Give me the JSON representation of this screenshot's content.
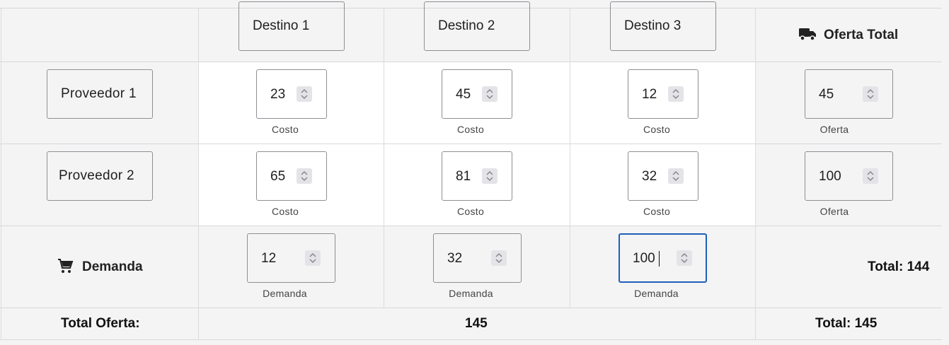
{
  "header": {
    "destinations": [
      "Destino 1",
      "Destino 2",
      "Destino 3"
    ],
    "supply_total_label": "Oferta Total",
    "supply_total_icon": "truck-icon"
  },
  "rows": [
    {
      "provider": "Proveedor 1",
      "costs": [
        "23",
        "45",
        "12"
      ],
      "cost_caption": "Costo",
      "supply": "45",
      "supply_caption": "Oferta"
    },
    {
      "provider": "Proveedor 2",
      "costs": [
        "65",
        "81",
        "32"
      ],
      "cost_caption": "Costo",
      "supply": "100",
      "supply_caption": "Oferta"
    }
  ],
  "demand": {
    "label": "Demanda",
    "icon": "cart-icon",
    "values": [
      "12",
      "32",
      "100"
    ],
    "caption": "Demanda",
    "total": "Total: 144"
  },
  "footer": {
    "label": "Total Oferta:",
    "value": "145",
    "total": "Total: 145"
  },
  "colors": {
    "focus": "#1f5fb8",
    "white_cells": "#ffffff",
    "background": "#f4f4f5"
  }
}
